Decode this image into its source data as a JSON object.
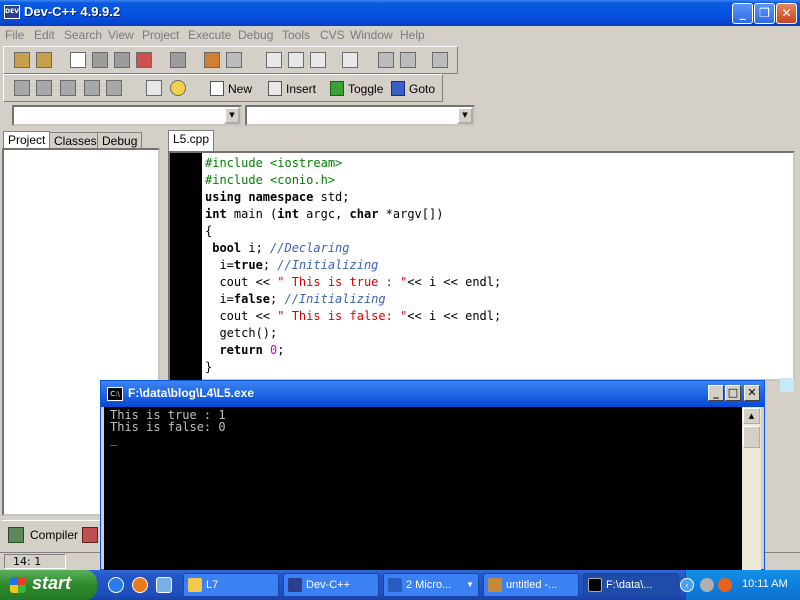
{
  "window": {
    "title": "Dev-C++ 4.9.9.2",
    "app_icon_text": "DEV"
  },
  "menu": [
    "File",
    "Edit",
    "Search",
    "View",
    "Project",
    "Execute",
    "Debug",
    "Tools",
    "CVS",
    "Window",
    "Help"
  ],
  "toolbar2": {
    "new_label": "New",
    "insert_label": "Insert",
    "toggle_label": "Toggle",
    "goto_label": "Goto"
  },
  "left_tabs": [
    "Project",
    "Classes",
    "Debug"
  ],
  "editor": {
    "tab": "L5.cpp",
    "lines": [
      [
        {
          "t": "#include <iostream>",
          "c": "pp"
        }
      ],
      [
        {
          "t": "#include <conio.h>",
          "c": "pp"
        }
      ],
      [
        {
          "t": "using namespace",
          "c": "kw"
        },
        {
          "t": " std;",
          "c": ""
        }
      ],
      [
        {
          "t": "int",
          "c": "kw"
        },
        {
          "t": " main (",
          "c": ""
        },
        {
          "t": "int",
          "c": "kw"
        },
        {
          "t": " argc, ",
          "c": ""
        },
        {
          "t": "char",
          "c": "kw"
        },
        {
          "t": " *argv[])",
          "c": ""
        }
      ],
      [
        {
          "t": "{",
          "c": ""
        }
      ],
      [
        {
          "t": " bool",
          "c": "kw"
        },
        {
          "t": " i; ",
          "c": ""
        },
        {
          "t": "//Declaring",
          "c": "cm"
        }
      ],
      [
        {
          "t": "  i=",
          "c": ""
        },
        {
          "t": "true",
          "c": "kw"
        },
        {
          "t": "; ",
          "c": ""
        },
        {
          "t": "//Initializing",
          "c": "cm"
        }
      ],
      [
        {
          "t": "  cout << ",
          "c": ""
        },
        {
          "t": "\" This is true : \"",
          "c": "st"
        },
        {
          "t": "<< i << endl;",
          "c": ""
        }
      ],
      [
        {
          "t": "  i=",
          "c": ""
        },
        {
          "t": "false",
          "c": "kw"
        },
        {
          "t": "; ",
          "c": ""
        },
        {
          "t": "//Initializing",
          "c": "cm"
        }
      ],
      [
        {
          "t": "  cout << ",
          "c": ""
        },
        {
          "t": "\" This is false: \"",
          "c": "st"
        },
        {
          "t": "<< i << endl;",
          "c": ""
        }
      ],
      [
        {
          "t": "  getch();",
          "c": ""
        }
      ],
      [
        {
          "t": "  return",
          "c": "kw"
        },
        {
          "t": " ",
          "c": ""
        },
        {
          "t": "0",
          "c": "nm"
        },
        {
          "t": ";",
          "c": ""
        }
      ],
      [
        {
          "t": "}",
          "c": ""
        }
      ]
    ]
  },
  "console": {
    "icon_text": "C:\\",
    "title": "F:\\data\\blog\\L4\\L5.exe",
    "output": "This is true : 1\nThis is false: 0\n_"
  },
  "bottom": {
    "compiler_tab": "Compiler",
    "cursor_pos": "14: 1"
  },
  "taskbar": {
    "start_label": "start",
    "tasks": [
      {
        "label": "L7",
        "color": "#f2c94c"
      },
      {
        "label": "Dev-C++",
        "color": "#2b3e8c"
      },
      {
        "label": "2 Micro...",
        "color": "#2a5bbf"
      },
      {
        "label": "untitled -...",
        "color": "#c48a3a"
      },
      {
        "label": "F:\\data\\...",
        "color": "#000000"
      }
    ],
    "clock": "10:11 AM"
  }
}
